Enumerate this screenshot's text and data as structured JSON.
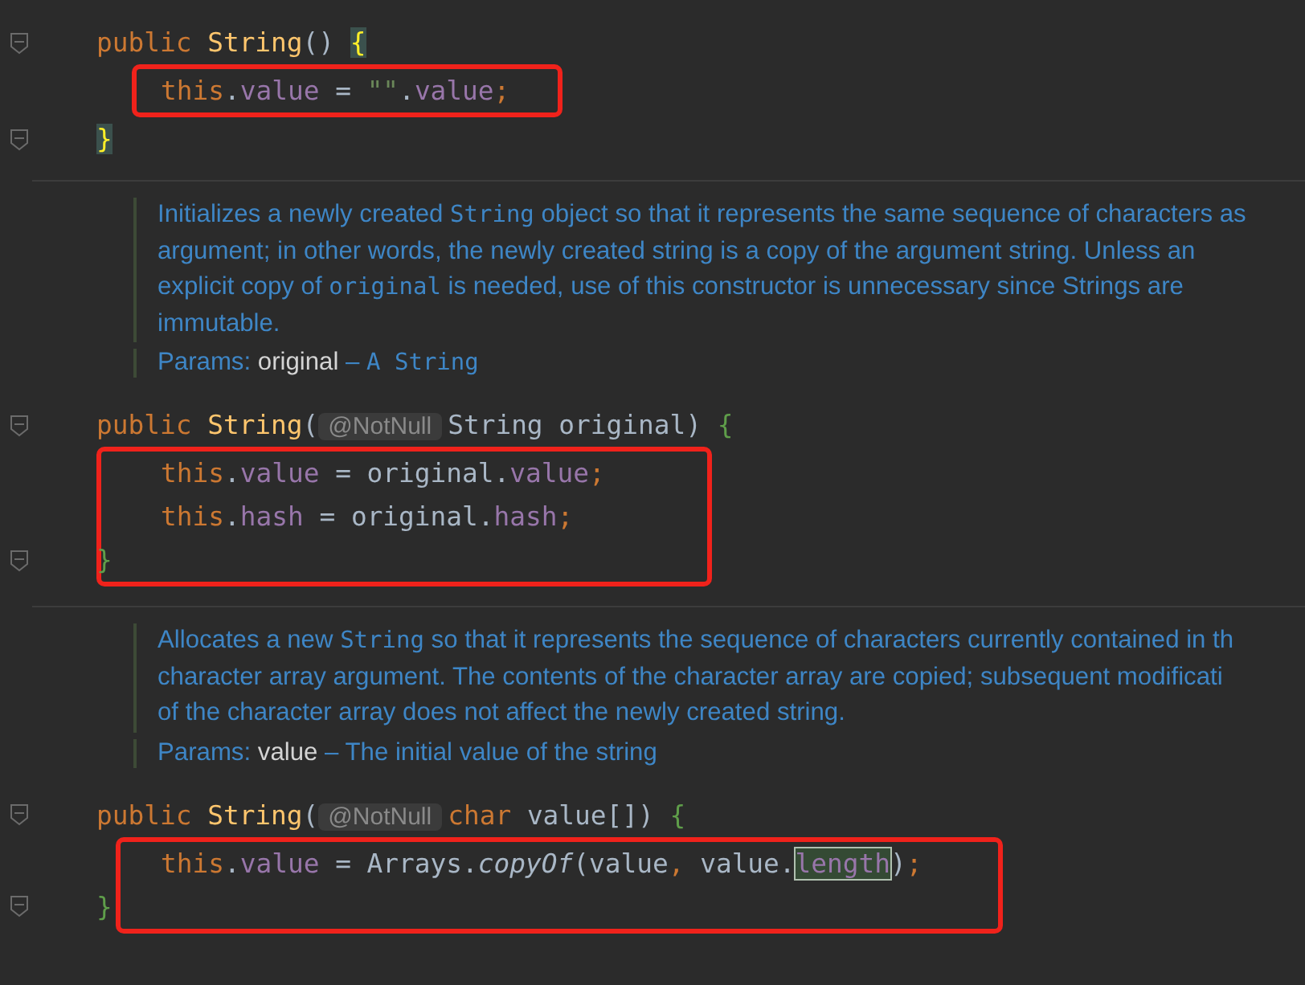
{
  "blocks": [
    {
      "kind": "code",
      "body_boxed": true,
      "closing_boxed": false,
      "signature": [
        {
          "t": "public ",
          "kind": "keyword"
        },
        {
          "t": "String",
          "kind": "declaration"
        },
        {
          "t": "() ",
          "kind": "plain"
        },
        {
          "t": "{",
          "kind": "bracematch"
        }
      ],
      "body": [
        [
          {
            "t": "this",
            "kind": "keyword"
          },
          {
            "t": ".",
            "kind": "plain"
          },
          {
            "t": "value",
            "kind": "field"
          },
          {
            "t": " = ",
            "kind": "plain"
          },
          {
            "t": "\"\"",
            "kind": "string"
          },
          {
            "t": ".",
            "kind": "plain"
          },
          {
            "t": "value",
            "kind": "field"
          },
          {
            "t": ";",
            "kind": "keyword"
          }
        ]
      ],
      "closing": [
        {
          "t": "}",
          "kind": "bracematch"
        }
      ]
    },
    {
      "kind": "doc",
      "lines": [
        [
          {
            "t": "Initializes a newly created ",
            "kind": "text"
          },
          {
            "t": "String",
            "kind": "code"
          },
          {
            "t": " object so that it represents the same sequence of characters as",
            "kind": "text"
          }
        ],
        [
          {
            "t": "argument; in other words, the newly created string is a copy of the argument string. Unless an",
            "kind": "text"
          }
        ],
        [
          {
            "t": "explicit copy of ",
            "kind": "text"
          },
          {
            "t": "original",
            "kind": "code"
          },
          {
            "t": " is needed, use of this constructor is unnecessary since Strings are",
            "kind": "text"
          }
        ],
        [
          {
            "t": "immutable.",
            "kind": "text"
          }
        ]
      ],
      "params": {
        "label": "Params:",
        "name": "original",
        "desc": [
          {
            "t": " – ",
            "kind": "text"
          },
          {
            "t": "A String",
            "kind": "code"
          }
        ]
      }
    },
    {
      "kind": "code",
      "body_boxed": true,
      "closing_boxed": true,
      "signature": [
        {
          "t": "public ",
          "kind": "keyword"
        },
        {
          "t": "String",
          "kind": "declaration"
        },
        {
          "t": "(",
          "kind": "plain"
        },
        {
          "t": "@NotNull",
          "kind": "hint"
        },
        {
          "t": "String original) ",
          "kind": "plain"
        },
        {
          "t": "{",
          "kind": "brace"
        }
      ],
      "body": [
        [
          {
            "t": "this",
            "kind": "keyword"
          },
          {
            "t": ".",
            "kind": "plain"
          },
          {
            "t": "value",
            "kind": "field"
          },
          {
            "t": " = original.",
            "kind": "plain"
          },
          {
            "t": "value",
            "kind": "field"
          },
          {
            "t": ";",
            "kind": "keyword"
          }
        ],
        [
          {
            "t": "this",
            "kind": "keyword"
          },
          {
            "t": ".",
            "kind": "plain"
          },
          {
            "t": "hash",
            "kind": "field"
          },
          {
            "t": " = original.",
            "kind": "plain"
          },
          {
            "t": "hash",
            "kind": "field"
          },
          {
            "t": ";",
            "kind": "keyword"
          }
        ]
      ],
      "closing": [
        {
          "t": "}",
          "kind": "brace"
        }
      ]
    },
    {
      "kind": "doc",
      "lines": [
        [
          {
            "t": "Allocates a new ",
            "kind": "text"
          },
          {
            "t": "String",
            "kind": "code"
          },
          {
            "t": " so that it represents the sequence of characters currently contained in th",
            "kind": "text"
          }
        ],
        [
          {
            "t": "character array argument. The contents of the character array are copied; subsequent modificati",
            "kind": "text"
          }
        ],
        [
          {
            "t": "of the character array does not affect the newly created string.",
            "kind": "text"
          }
        ]
      ],
      "params": {
        "label": "Params:",
        "name": "value",
        "desc": [
          {
            "t": " – The initial value of the string",
            "kind": "text"
          }
        ]
      }
    },
    {
      "kind": "code",
      "body_boxed": true,
      "closing_boxed": true,
      "signature": [
        {
          "t": "public ",
          "kind": "keyword"
        },
        {
          "t": "String",
          "kind": "declaration"
        },
        {
          "t": "(",
          "kind": "plain"
        },
        {
          "t": "@NotNull",
          "kind": "hint"
        },
        {
          "t": "char ",
          "kind": "keyword"
        },
        {
          "t": "value[]) ",
          "kind": "plain"
        },
        {
          "t": "{",
          "kind": "brace"
        }
      ],
      "body": [
        [
          {
            "t": "this",
            "kind": "keyword"
          },
          {
            "t": ".",
            "kind": "plain"
          },
          {
            "t": "value",
            "kind": "field"
          },
          {
            "t": " = Arrays.",
            "kind": "plain"
          },
          {
            "t": "copyOf",
            "kind": "method"
          },
          {
            "t": "(value",
            "kind": "plain"
          },
          {
            "t": ", ",
            "kind": "keyword"
          },
          {
            "t": "value.",
            "kind": "plain"
          },
          {
            "t": "length",
            "kind": "selected"
          },
          {
            "t": ")",
            "kind": "plain"
          },
          {
            "t": ";",
            "kind": "keyword"
          }
        ]
      ],
      "closing": [
        {
          "t": "}",
          "kind": "brace"
        }
      ]
    }
  ]
}
